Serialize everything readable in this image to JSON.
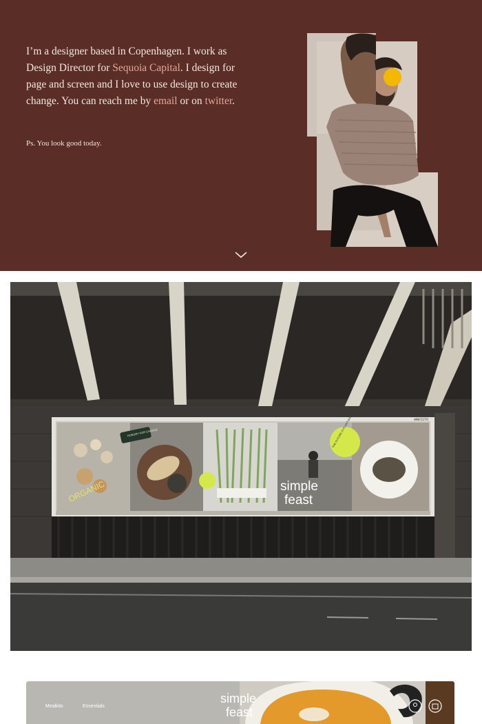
{
  "intro": {
    "t1": "I’m a designer based in Copenhagen. I work as Design Director for ",
    "link_sequoia": "Sequoia Capital",
    "t2": ". I design for page and screen and I love to use design to create change. You can reach me by ",
    "link_email": "email",
    "t3": " or on ",
    "link_twitter": "twitter",
    "t4": "."
  },
  "ps": "Ps. You look good today.",
  "billboard": {
    "badge_top": "HUNGRY FOR CHANGE",
    "organic": "ORGANIC",
    "ring_text": "THE FUTURE IS PLANT-BASED",
    "logo_line1": "simple",
    "logo_line2": "feast",
    "corner_tag": "ARKISTO"
  },
  "site_preview": {
    "nav_1": "Mealkits",
    "nav_2": "Essentials",
    "logo_line1": "simple",
    "logo_line2": "feast"
  },
  "colors": {
    "hero_bg": "#5a2d26",
    "link": "#e6a79a",
    "accent_dot": "#f5b800",
    "lime": "#d4e84a"
  }
}
